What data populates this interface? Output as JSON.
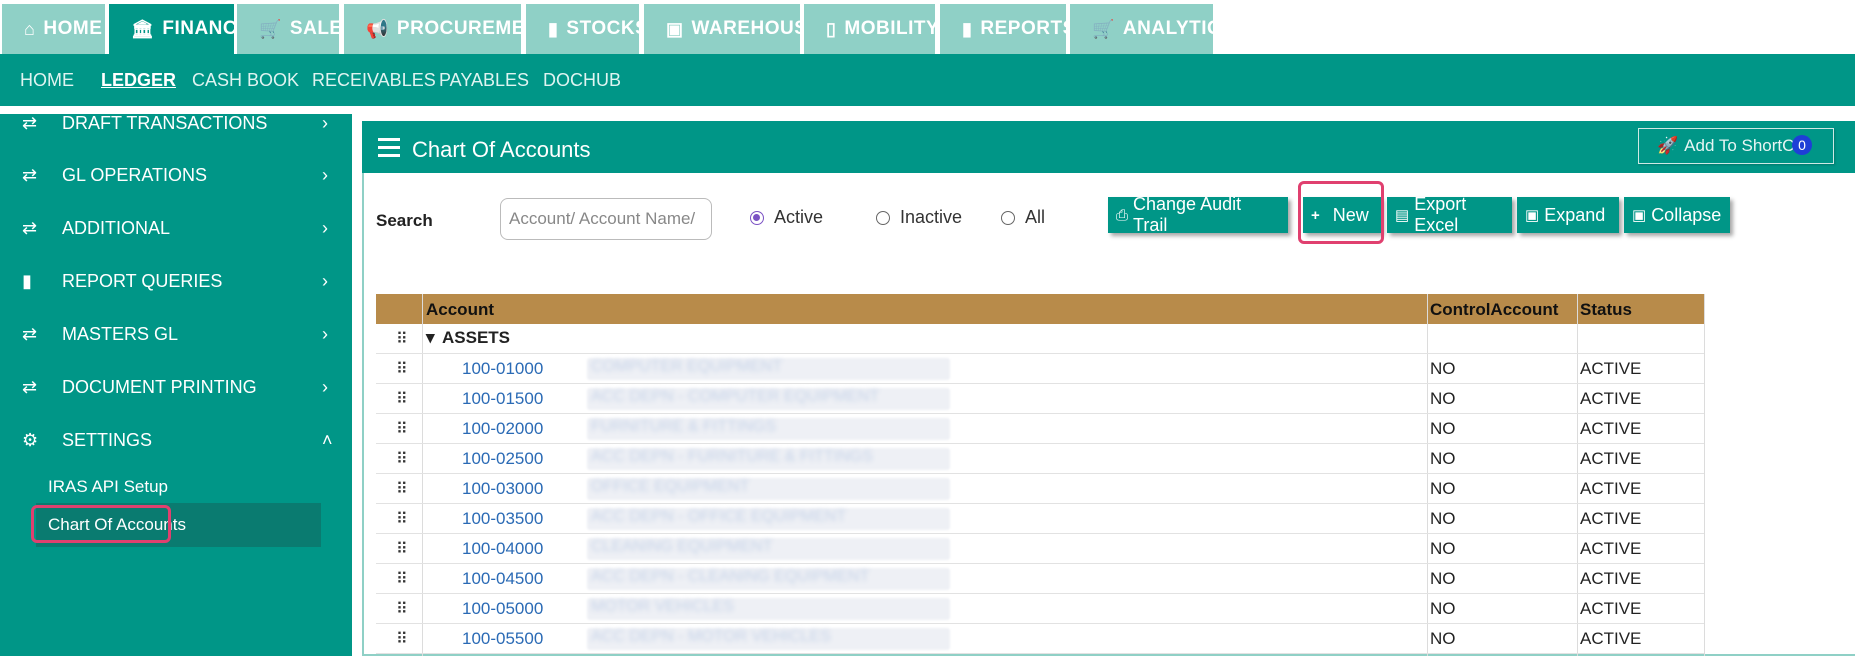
{
  "top_tabs": [
    {
      "label": "HOME",
      "icon": "home-icon"
    },
    {
      "label": "FINANCE",
      "icon": "bank-icon"
    },
    {
      "label": "SALES",
      "icon": "cart-icon"
    },
    {
      "label": "PROCUREMENT",
      "icon": "bullhorn-icon"
    },
    {
      "label": "STOCKS",
      "icon": "bar-chart-icon"
    },
    {
      "label": "WAREHOUSE",
      "icon": "box-icon"
    },
    {
      "label": "MOBILITY",
      "icon": "mobile-icon"
    },
    {
      "label": "REPORTS",
      "icon": "bar-chart-icon"
    },
    {
      "label": "ANALYTICS",
      "icon": "cart-icon"
    }
  ],
  "sub_nav": [
    "HOME",
    "LEDGER",
    "CASH BOOK",
    "RECEIVABLES",
    "PAYABLES",
    "DOCHUB"
  ],
  "sidebar": {
    "items": [
      {
        "label": "DRAFT TRANSACTIONS",
        "icon": "exchange-icon"
      },
      {
        "label": "GL OPERATIONS",
        "icon": "exchange-icon"
      },
      {
        "label": "ADDITIONAL",
        "icon": "exchange-icon"
      },
      {
        "label": "REPORT QUERIES",
        "icon": "bar-chart-icon"
      },
      {
        "label": "MASTERS GL",
        "icon": "exchange-icon"
      },
      {
        "label": "DOCUMENT PRINTING",
        "icon": "exchange-icon"
      },
      {
        "label": "SETTINGS",
        "icon": "gears-icon"
      }
    ],
    "sub_items": [
      "IRAS API Setup",
      "Chart Of Accounts"
    ]
  },
  "panel": {
    "title": "Chart Of Accounts",
    "shortcut_label": "Add To ShortCut",
    "shortcut_badge": "0"
  },
  "search": {
    "label": "Search",
    "placeholder": "Account/ Account Name/",
    "radios": [
      "Active",
      "Inactive",
      "All"
    ],
    "selected": "Active"
  },
  "buttons": {
    "audit": "Change Audit Trail",
    "new": "New",
    "export": "Export Excel",
    "expand": "Expand",
    "collapse": "Collapse"
  },
  "table": {
    "headers": [
      "Account",
      "ControlAccount",
      "Status"
    ],
    "group": "ASSETS",
    "rows": [
      {
        "code": "100-01000",
        "name": "COMPUTER EQUIPMENT",
        "control": "NO",
        "status": "ACTIVE"
      },
      {
        "code": "100-01500",
        "name": "ACC DEPN - COMPUTER EQUIPMENT",
        "control": "NO",
        "status": "ACTIVE"
      },
      {
        "code": "100-02000",
        "name": "FURNITURE & FITTINGS",
        "control": "NO",
        "status": "ACTIVE"
      },
      {
        "code": "100-02500",
        "name": "ACC DEPN - FURNITURE & FITTINGS",
        "control": "NO",
        "status": "ACTIVE"
      },
      {
        "code": "100-03000",
        "name": "OFFICE EQUIPMENT",
        "control": "NO",
        "status": "ACTIVE"
      },
      {
        "code": "100-03500",
        "name": "ACC DEPN - OFFICE EQUIPMENT",
        "control": "NO",
        "status": "ACTIVE"
      },
      {
        "code": "100-04000",
        "name": "CLEANING EQUIPMENT",
        "control": "NO",
        "status": "ACTIVE"
      },
      {
        "code": "100-04500",
        "name": "ACC DEPN - CLEANING EQUIPMENT",
        "control": "NO",
        "status": "ACTIVE"
      },
      {
        "code": "100-05000",
        "name": "MOTOR VEHICLES",
        "control": "NO",
        "status": "ACTIVE"
      },
      {
        "code": "100-05500",
        "name": "ACC DEPN - MOTOR VEHICLES",
        "control": "NO",
        "status": "ACTIVE"
      }
    ]
  },
  "colors": {
    "primary": "#009687",
    "tab_inactive": "#8fd0c6",
    "table_header": "#b88b4a",
    "highlight": "#e0406f"
  }
}
